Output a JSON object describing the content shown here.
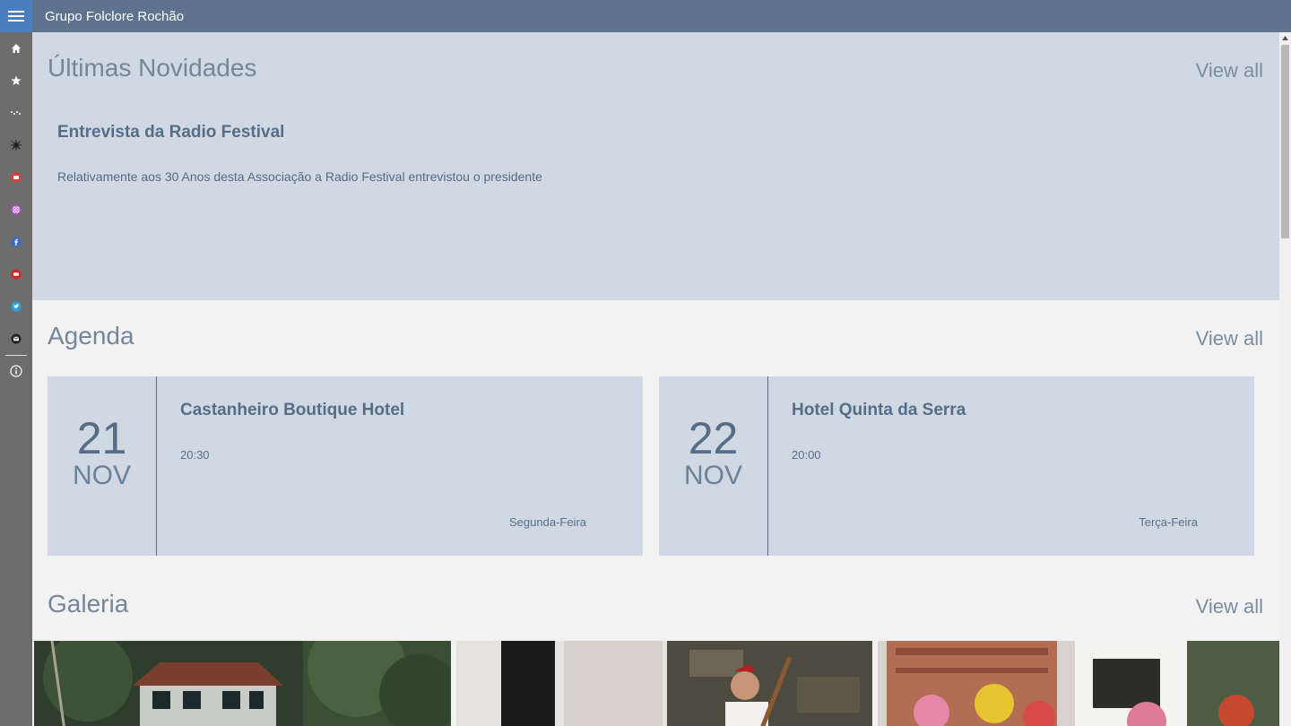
{
  "app": {
    "title": "Grupo Folclore Rochão"
  },
  "sidebar": {
    "items": [
      {
        "icon": "home-icon"
      },
      {
        "icon": "star-icon"
      },
      {
        "icon": "stars-icon"
      },
      {
        "icon": "logo-icon"
      },
      {
        "icon": "youtube-icon"
      },
      {
        "icon": "instagram-icon"
      },
      {
        "icon": "facebook-icon"
      },
      {
        "icon": "youtube-red-icon"
      },
      {
        "icon": "twitter-icon"
      },
      {
        "icon": "mail-icon"
      },
      {
        "icon": "info-icon"
      }
    ]
  },
  "news": {
    "heading": "Últimas Novidades",
    "view_all": "View all",
    "title": "Entrevista da Radio Festival",
    "text": "Relativamente aos 30 Anos desta Associação a Radio Festival entrevistou o presidente"
  },
  "agenda": {
    "heading": "Agenda",
    "view_all": "View all",
    "events": [
      {
        "day": "21",
        "month": "NOV",
        "name": "Castanheiro Boutique Hotel",
        "time": "20:30",
        "weekday": "Segunda-Feira"
      },
      {
        "day": "22",
        "month": "NOV",
        "name": "Hotel Quinta da Serra",
        "time": "20:00",
        "weekday": "Terça-Feira"
      }
    ]
  },
  "gallery": {
    "heading": "Galeria",
    "view_all": "View all"
  },
  "colors": {
    "titlebar": "#5d738e",
    "hamburger": "#4a7fc0",
    "sidebar": "#6d6d6d",
    "panel": "#cfd8e3",
    "accent_text": "#566d88"
  }
}
